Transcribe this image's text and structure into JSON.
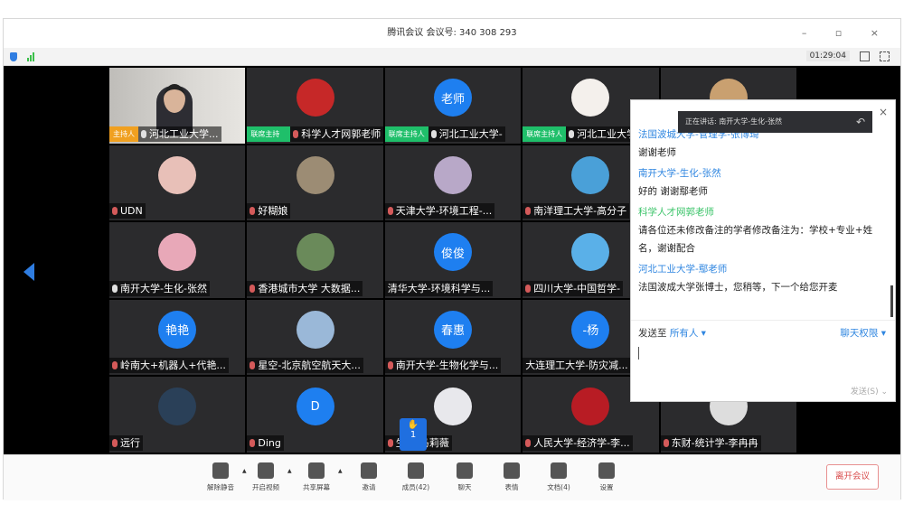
{
  "titlebar": {
    "title": "腾讯会议 会议号: 340 308 293",
    "controls": "– ▫ ×"
  },
  "infobar": {
    "timer": "01:29:04"
  },
  "tiles": [
    {
      "name": "河北工业大学...",
      "badge": "主持人",
      "badge_color": "#f0a020",
      "video": true,
      "mic": "on"
    },
    {
      "name": "科学人才网郭老师",
      "badge": "联席主持人",
      "badge_color": "#1fbf6a",
      "avatar": "",
      "avatar_color": "#c62828",
      "mic": "muted"
    },
    {
      "name": "河北工业大学-",
      "badge": "联席主持人",
      "badge_color": "#1fbf6a",
      "avatar": "老师",
      "avatar_color": "#1e7ff0",
      "mic": "on"
    },
    {
      "name": "河北工业大学",
      "badge": "联席主持人",
      "badge_color": "#1fbf6a",
      "avatar": "",
      "avatar_color": "#f4f0ec",
      "mic": "on"
    },
    {
      "name": "",
      "avatar": "",
      "avatar_color": "#c9a070"
    },
    {
      "name": "UDN",
      "avatar": "",
      "avatar_color": "#e8c0b8",
      "mic": "muted"
    },
    {
      "name": "好糊娘",
      "avatar": "",
      "avatar_color": "#9c8c74",
      "mic": "muted"
    },
    {
      "name": "天津大学-环境工程-...",
      "avatar": "",
      "avatar_color": "#b8a8c8",
      "mic": "muted"
    },
    {
      "name": "南洋理工大学-高分子",
      "avatar": "",
      "avatar_color": "#4aa0d8",
      "mic": "muted"
    },
    {
      "name": "",
      "avatar": "",
      "avatar_color": "#555"
    },
    {
      "name": "南开大学-生化-张然",
      "avatar": "",
      "avatar_color": "#e8a8b8",
      "mic": "on"
    },
    {
      "name": "香港城市大学 大数据...",
      "avatar": "",
      "avatar_color": "#6a8a5a",
      "mic": "muted"
    },
    {
      "name": "清华大学-环境科学与...",
      "avatar": "俊俊",
      "avatar_color": "#1e7ff0"
    },
    {
      "name": "四川大学-中国哲学-",
      "avatar": "",
      "avatar_color": "#5ab0e8",
      "mic": "muted"
    },
    {
      "name": "",
      "avatar": "",
      "avatar_color": "#555"
    },
    {
      "name": "岭南大+机器人+代艳...",
      "avatar": "艳艳",
      "avatar_color": "#1e7ff0",
      "mic": "muted"
    },
    {
      "name": "星空-北京航空航天大...",
      "avatar": "",
      "avatar_color": "#9ab8d8",
      "mic": "muted"
    },
    {
      "name": "南开大学-生物化学与...",
      "avatar": "春惠",
      "avatar_color": "#1e7ff0",
      "mic": "muted"
    },
    {
      "name": "大连理工大学-防灾减...",
      "avatar": "-杨",
      "avatar_color": "#1e7ff0"
    },
    {
      "name": "",
      "avatar": "",
      "avatar_color": "#555"
    },
    {
      "name": "远行",
      "avatar": "",
      "avatar_color": "#2a4058",
      "mic": "muted"
    },
    {
      "name": "Ding",
      "avatar": "D",
      "avatar_color": "#1e7ff0",
      "mic": "muted"
    },
    {
      "name": "生态-马莉薇",
      "avatar": "",
      "avatar_color": "#e8e8ec",
      "mic": "muted"
    },
    {
      "name": "人民大学-经济学-李...",
      "avatar": "",
      "avatar_color": "#b81c24",
      "mic": "muted"
    },
    {
      "name": "东财-统计学-李冉冉",
      "avatar": "",
      "avatar_color": "#ddd",
      "mic": "muted"
    }
  ],
  "raise_hand": {
    "count": "1"
  },
  "speaking": {
    "text": "正在讲话: 南开大学-生化-张然",
    "reply_icon": "↶"
  },
  "chat": {
    "close": "×",
    "messages": [
      {
        "sender": "法国波城大学-管理学-张博琦",
        "text": "谢谢老师",
        "color": "blue"
      },
      {
        "sender": "南开大学-生化-张然",
        "text": "好的 谢谢鄢老师",
        "color": "blue"
      },
      {
        "sender": "科学人才网郭老师",
        "text": "请各位还未修改备注的学者修改备注为：学校+专业+姓名，谢谢配合",
        "color": "green"
      },
      {
        "sender": "河北工业大学-鄢老师",
        "text": "法国波成大学张博士，您稍等，下一个给您开麦",
        "color": "blue"
      }
    ],
    "send_to_label": "发送至",
    "send_to_value": "所有人 ▾",
    "permission": "聊天权限 ▾",
    "send_button": "发送(S) ⌄"
  },
  "toolbar": {
    "items": [
      {
        "label": "解除静音",
        "icon": "mic-muted-icon"
      },
      {
        "label": "开启视频",
        "icon": "camera-off-icon"
      },
      {
        "label": "共享屏幕",
        "icon": "share-screen-icon"
      },
      {
        "label": "邀请",
        "icon": "invite-icon"
      },
      {
        "label": "成员(42)",
        "icon": "members-icon"
      },
      {
        "label": "聊天",
        "icon": "chat-icon"
      },
      {
        "label": "表情",
        "icon": "emoji-icon"
      },
      {
        "label": "文档(4)",
        "icon": "document-icon"
      },
      {
        "label": "设置",
        "icon": "settings-icon"
      }
    ],
    "leave": "离开会议"
  }
}
